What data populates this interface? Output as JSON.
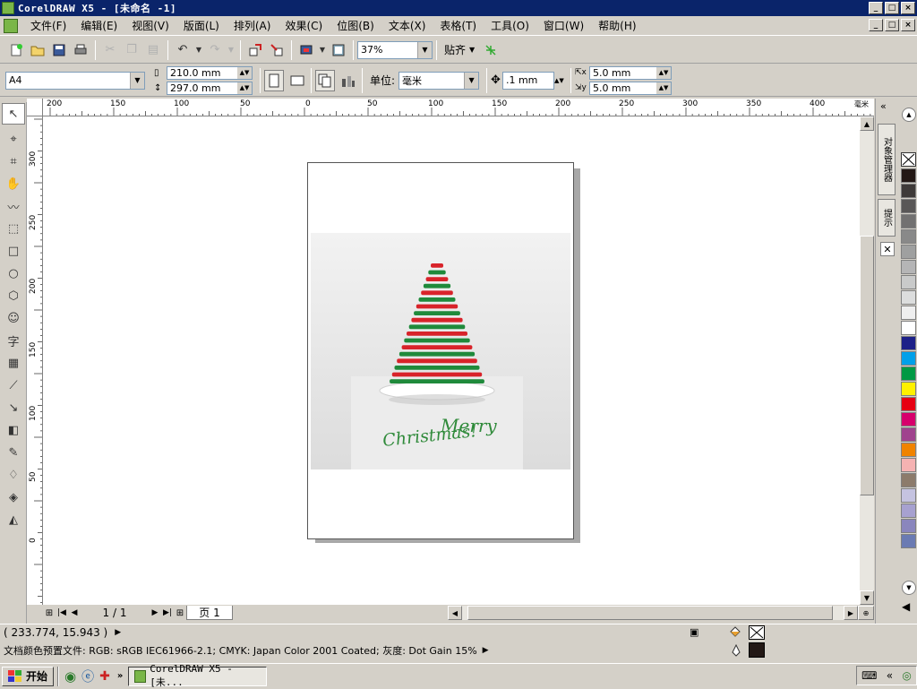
{
  "window": {
    "title": "CorelDRAW X5 - [未命名 -1]",
    "controls": [
      "_",
      "□",
      "×"
    ]
  },
  "menu": {
    "items": [
      "文件(F)",
      "编辑(E)",
      "视图(V)",
      "版面(L)",
      "排列(A)",
      "效果(C)",
      "位图(B)",
      "文本(X)",
      "表格(T)",
      "工具(O)",
      "窗口(W)",
      "帮助(H)"
    ]
  },
  "toolbar": {
    "zoom": "37%",
    "snap_label": "贴齐"
  },
  "property_bar": {
    "paper_size": "A4",
    "width": "210.0 mm",
    "height": "297.0 mm",
    "units_label": "单位:",
    "units_value": "毫米",
    "nudge": ".1 mm",
    "dup_x": "5.0 mm",
    "dup_y": "5.0 mm"
  },
  "ruler": {
    "top_labels": [
      "200",
      "150",
      "100",
      "50",
      "0",
      "50",
      "100",
      "150",
      "200",
      "250",
      "300",
      "350",
      "400"
    ],
    "top_unit": "毫米",
    "left_labels": [
      "300",
      "250",
      "200",
      "150",
      "100",
      "50",
      "0"
    ]
  },
  "artwork": {
    "greeting_line1": "Merry",
    "greeting_line2": "Christmas!",
    "stripe_colors": [
      "#d8232a",
      "#1f8a3b"
    ],
    "greeting_color": "#2f8a3a"
  },
  "page_nav": {
    "page_counter": "1 / 1",
    "page_tab": "页 1"
  },
  "docker": {
    "tab1": "对象管理器",
    "tab2": "提示"
  },
  "palette": {
    "colors": [
      "#231815",
      "#3e3a39",
      "#595757",
      "#727171",
      "#898989",
      "#9fa0a0",
      "#b5b5b6",
      "#c9caca",
      "#dcdddd",
      "#efefef",
      "#ffffff",
      "#1d2088",
      "#00a0e9",
      "#009944",
      "#fff100",
      "#e60012",
      "#d7006c",
      "#a0438e",
      "#f08300",
      "#f5b2b2",
      "#8c7b6b",
      "#c5c3e0",
      "#a7a1d0",
      "#8a86bd",
      "#6b7bb3"
    ]
  },
  "status": {
    "coords": "( 233.774, 15.943 )",
    "color_profile": "文档颜色预置文件: RGB: sRGB IEC61966-2.1; CMYK: Japan Color 2001 Coated; 灰度: Dot Gain 15%"
  },
  "taskbar": {
    "start": "开始",
    "task": "CorelDRAW X5 - [未..."
  }
}
